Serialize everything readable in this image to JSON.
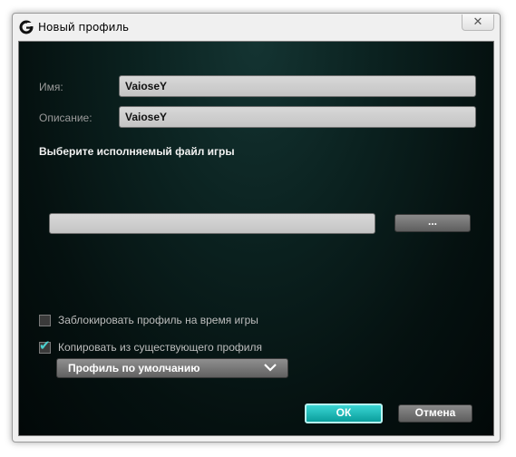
{
  "window": {
    "title": "Новый профиль",
    "app_icon": "logitech-g-icon",
    "close_icon": "close-icon"
  },
  "form": {
    "name_label": "Имя:",
    "name_value": "VaioseY",
    "description_label": "Описание:",
    "description_value": "VaioseY",
    "exe_section_title": "Выберите исполняемый файл игры",
    "exe_path_value": "",
    "browse_label": "...",
    "lock_label": "Заблокировать профиль на время игры",
    "lock_checked": false,
    "copy_label": "Копировать из существующего профиля",
    "copy_checked": true,
    "profile_select_value": "Профиль по умолчанию"
  },
  "buttons": {
    "ok": "ОК",
    "cancel": "Отмена"
  },
  "colors": {
    "accent": "#1bbab8",
    "background": "#051110",
    "field": "#cfcfcf"
  }
}
